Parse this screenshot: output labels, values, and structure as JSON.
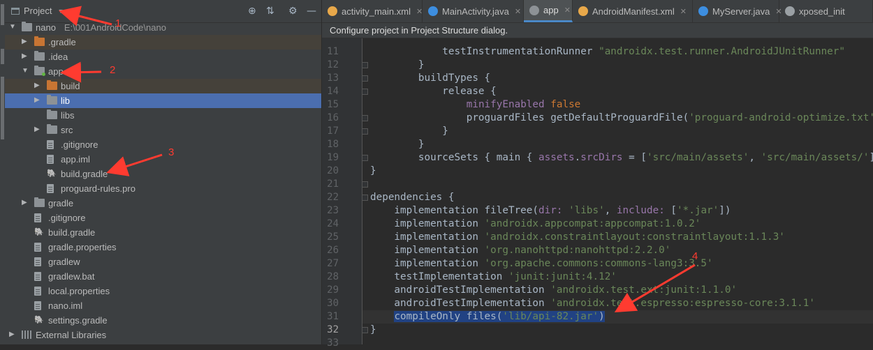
{
  "project_panel": {
    "title": "Project",
    "tree": [
      {
        "label": "nano",
        "path": "E:\\001AndroidCode\\nano",
        "depth": 0,
        "expanded": true,
        "icon": "folder",
        "style": ""
      },
      {
        "label": ".gradle",
        "depth": 1,
        "expanded": false,
        "icon": "folder-orange",
        "style": "brown"
      },
      {
        "label": ".idea",
        "depth": 1,
        "expanded": false,
        "icon": "folder",
        "style": ""
      },
      {
        "label": "app",
        "depth": 1,
        "expanded": true,
        "icon": "folder-module",
        "style": ""
      },
      {
        "label": "build",
        "depth": 2,
        "expanded": false,
        "icon": "folder-orange",
        "style": "brown"
      },
      {
        "label": "lib",
        "depth": 2,
        "expanded": false,
        "icon": "folder",
        "style": "selected"
      },
      {
        "label": "libs",
        "depth": 2,
        "icon": "folder",
        "style": ""
      },
      {
        "label": "src",
        "depth": 2,
        "expanded": false,
        "icon": "folder",
        "style": ""
      },
      {
        "label": ".gitignore",
        "depth": 2,
        "icon": "file",
        "style": ""
      },
      {
        "label": "app.iml",
        "depth": 2,
        "icon": "file",
        "style": ""
      },
      {
        "label": "build.gradle",
        "depth": 2,
        "icon": "gradle",
        "style": ""
      },
      {
        "label": "proguard-rules.pro",
        "depth": 2,
        "icon": "file",
        "style": ""
      },
      {
        "label": "gradle",
        "depth": 1,
        "expanded": false,
        "icon": "folder",
        "style": ""
      },
      {
        "label": ".gitignore",
        "depth": 1,
        "icon": "file",
        "style": ""
      },
      {
        "label": "build.gradle",
        "depth": 1,
        "icon": "gradle",
        "style": ""
      },
      {
        "label": "gradle.properties",
        "depth": 1,
        "icon": "file",
        "style": ""
      },
      {
        "label": "gradlew",
        "depth": 1,
        "icon": "file",
        "style": ""
      },
      {
        "label": "gradlew.bat",
        "depth": 1,
        "icon": "file",
        "style": ""
      },
      {
        "label": "local.properties",
        "depth": 1,
        "icon": "file",
        "style": ""
      },
      {
        "label": "nano.iml",
        "depth": 1,
        "icon": "file",
        "style": ""
      },
      {
        "label": "settings.gradle",
        "depth": 1,
        "icon": "gradle",
        "style": ""
      },
      {
        "label": "External Libraries",
        "depth": 0,
        "expanded": false,
        "icon": "libs",
        "style": ""
      }
    ]
  },
  "tabs": [
    {
      "label": "activity_main.xml",
      "icon_color": "#e8a84a",
      "active": false
    },
    {
      "label": "MainActivity.java",
      "icon_color": "#3d8ee0",
      "active": false
    },
    {
      "label": "app",
      "icon_color": "#8d9296",
      "active": true
    },
    {
      "label": "AndroidManifest.xml",
      "icon_color": "#e8a84a",
      "active": false
    },
    {
      "label": "MyServer.java",
      "icon_color": "#3d8ee0",
      "active": false
    },
    {
      "label": "xposed_init",
      "icon_color": "#9aa0a4",
      "active": false
    }
  ],
  "notice": "Configure project in Project Structure dialog.",
  "code": {
    "first_line": 11,
    "current_line": 32,
    "lines": [
      [
        {
          "t": "            testInstrumentationRunner "
        },
        {
          "t": "\"androidx.test.runner.AndroidJUnitRunner\"",
          "c": "str"
        }
      ],
      [
        {
          "t": "        }"
        }
      ],
      [
        {
          "t": "        buildTypes {"
        }
      ],
      [
        {
          "t": "            release {"
        }
      ],
      [
        {
          "t": "                "
        },
        {
          "t": "minifyEnabled",
          "c": "prop"
        },
        {
          "t": " "
        },
        {
          "t": "false",
          "c": "kw"
        }
      ],
      [
        {
          "t": "                proguardFiles getDefaultProguardFile("
        },
        {
          "t": "'proguard-android-optimize.txt'",
          "c": "str"
        }
      ],
      [
        {
          "t": "            }"
        }
      ],
      [
        {
          "t": "        }"
        }
      ],
      [
        {
          "t": "        sourceSets { main { "
        },
        {
          "t": "assets",
          "c": "prop"
        },
        {
          "t": "."
        },
        {
          "t": "srcDirs",
          "c": "prop"
        },
        {
          "t": " = ["
        },
        {
          "t": "'src/main/assets'",
          "c": "str"
        },
        {
          "t": ", "
        },
        {
          "t": "'src/main/assets/'",
          "c": "str"
        },
        {
          "t": "]"
        }
      ],
      [
        {
          "t": "}"
        }
      ],
      [
        {
          "t": ""
        }
      ],
      [
        {
          "t": "dependencies {"
        }
      ],
      [
        {
          "t": "    implementation fileTree("
        },
        {
          "t": "dir: ",
          "c": "prop"
        },
        {
          "t": "'libs'",
          "c": "str"
        },
        {
          "t": ", "
        },
        {
          "t": "include: ",
          "c": "prop"
        },
        {
          "t": "["
        },
        {
          "t": "'*.jar'",
          "c": "str"
        },
        {
          "t": "])"
        }
      ],
      [
        {
          "t": "    implementation "
        },
        {
          "t": "'androidx.appcompat:appcompat:1.0.2'",
          "c": "str"
        }
      ],
      [
        {
          "t": "    implementation "
        },
        {
          "t": "'androidx.constraintlayout:constraintlayout:1.1.3'",
          "c": "str"
        }
      ],
      [
        {
          "t": "    implementation "
        },
        {
          "t": "'org.nanohttpd:nanohttpd:2.2.0'",
          "c": "str"
        }
      ],
      [
        {
          "t": "    implementation "
        },
        {
          "t": "'org.apache.commons:commons-lang3:3.5'",
          "c": "str"
        }
      ],
      [
        {
          "t": "    testImplementation "
        },
        {
          "t": "'junit:junit:4.12'",
          "c": "str"
        }
      ],
      [
        {
          "t": "    androidTestImplementation "
        },
        {
          "t": "'androidx.test.ext:junit:1.1.0'",
          "c": "str"
        }
      ],
      [
        {
          "t": "    androidTestImplementation "
        },
        {
          "t": "'androidx.test.espresso:espresso-core:3.1.1'",
          "c": "str"
        }
      ],
      [
        {
          "t": "    "
        },
        {
          "t": "compileOnly files(",
          "sel": true
        },
        {
          "t": "'lib/api-82.jar'",
          "c": "str",
          "sel": true
        },
        {
          "t": ")",
          "sel": true
        }
      ],
      [
        {
          "t": "}"
        }
      ],
      [
        {
          "t": ""
        }
      ]
    ],
    "folds": [
      12,
      13,
      14,
      16,
      17,
      19,
      21,
      22,
      32
    ]
  },
  "annotations": {
    "a1": "1",
    "a2": "2",
    "a3": "3",
    "a4": "4",
    "color": "#ff3b30"
  }
}
